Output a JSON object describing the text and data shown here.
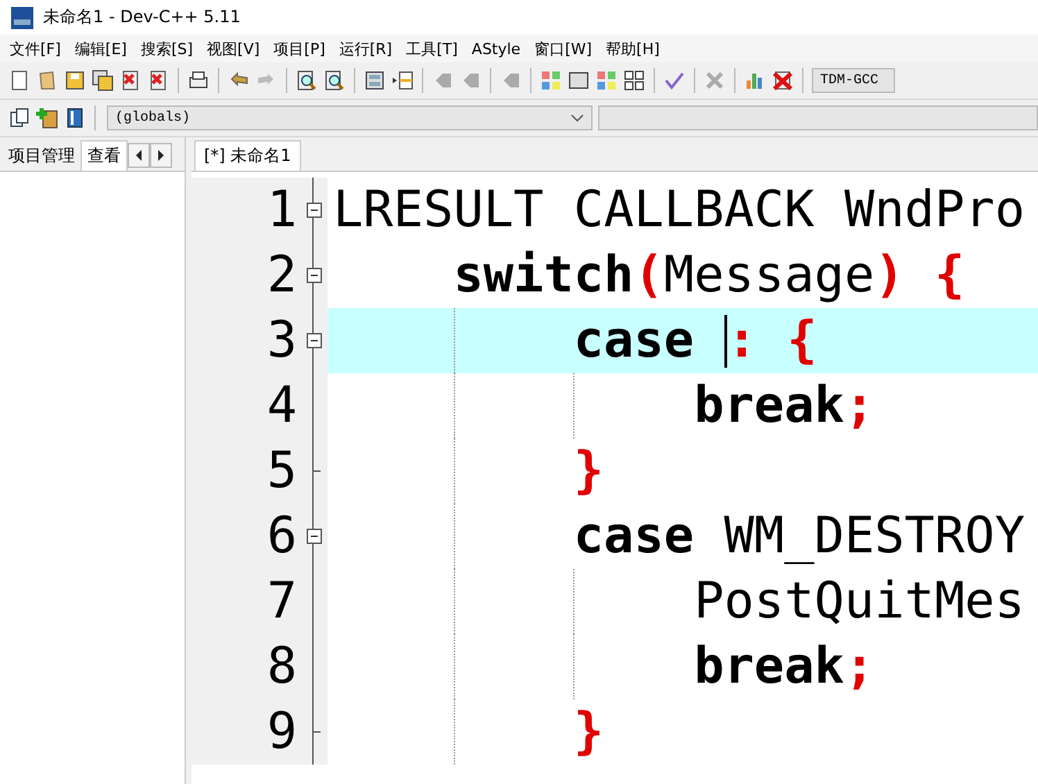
{
  "window": {
    "title": "未命名1 - Dev-C++ 5.11"
  },
  "menu": [
    {
      "label": "文件[F]"
    },
    {
      "label": "编辑[E]"
    },
    {
      "label": "搜索[S]"
    },
    {
      "label": "视图[V]"
    },
    {
      "label": "项目[P]"
    },
    {
      "label": "运行[R]"
    },
    {
      "label": "工具[T]"
    },
    {
      "label": "AStyle"
    },
    {
      "label": "窗口[W]"
    },
    {
      "label": "帮助[H]"
    }
  ],
  "compiler": {
    "value": "TDM-GCC"
  },
  "scope": {
    "value": "(globals)"
  },
  "left_tabs": [
    {
      "label": "项目管理",
      "selected": false
    },
    {
      "label": "查看",
      "selected": true
    }
  ],
  "editor_tabs": [
    {
      "label": "[*] 未命名1",
      "selected": true
    }
  ],
  "lines": [
    {
      "number": "1",
      "current": false,
      "tokens": [
        {
          "text": "LRESULT CALLBACK WndPro",
          "kind": "plain"
        }
      ],
      "children": [
        {
          "number": "2",
          "current": false,
          "tokens": [
            {
              "text": "switch",
              "kind": "keyword"
            },
            {
              "text": "(",
              "kind": "punct"
            },
            {
              "text": "Message",
              "kind": "plain"
            },
            {
              "text": ") {",
              "kind": "punct"
            }
          ],
          "children": [
            {
              "number": "3",
              "current": true,
              "tokens": [
                {
                  "text": "case ",
                  "kind": "keyword"
                },
                {
                  "text": ": {",
                  "kind": "punct"
                }
              ],
              "children": [
                {
                  "number": "4",
                  "current": false,
                  "tokens": [
                    {
                      "text": "break",
                      "kind": "keyword"
                    },
                    {
                      "text": ";",
                      "kind": "punct"
                    }
                  ]
                }
              ]
            },
            {
              "number": "5",
              "current": false,
              "tokens": [
                {
                  "text": "}",
                  "kind": "punct"
                }
              ]
            },
            {
              "number": "6",
              "current": false,
              "tokens": [
                {
                  "text": "case",
                  "kind": "keyword"
                },
                {
                  "text": " WM_DESTROY",
                  "kind": "plain"
                }
              ],
              "children": [
                {
                  "number": "7",
                  "current": false,
                  "tokens": [
                    {
                      "text": "PostQuitMes",
                      "kind": "plain"
                    }
                  ]
                },
                {
                  "number": "8",
                  "current": false,
                  "tokens": [
                    {
                      "text": "break",
                      "kind": "keyword"
                    },
                    {
                      "text": ";",
                      "kind": "punct"
                    }
                  ]
                }
              ]
            },
            {
              "number": "9",
              "current": false,
              "tokens": [
                {
                  "text": "}",
                  "kind": "punct"
                }
              ]
            }
          ]
        }
      ]
    }
  ]
}
